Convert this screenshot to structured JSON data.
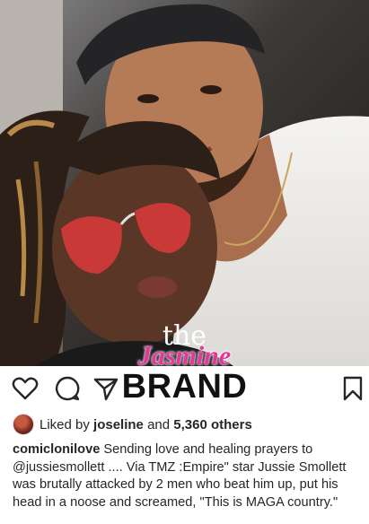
{
  "post": {
    "photo_alt": "selfie of two people",
    "watermark": {
      "line1": "the",
      "line2": "Jasmine"
    },
    "brand_text": "BRAND",
    "actions": {
      "like_icon": "heart-outline-icon",
      "comment_icon": "comment-bubble-icon",
      "share_icon": "paper-plane-icon",
      "save_icon": "bookmark-outline-icon"
    },
    "likes": {
      "prefix": "Liked by",
      "user": "joseline",
      "conjunction": "and",
      "count": "5,360 others"
    },
    "caption": {
      "username": "comiclonilove",
      "text": "Sending love and healing prayers to @jussiesmollett .... Via TMZ :Empire\" star Jussie Smollett was brutally attacked by 2 men who beat him up, put his head in a noose and screamed, \"This is MAGA country.\""
    }
  },
  "colors": {
    "watermark_pink": "#e5379a",
    "text": "#262626"
  }
}
